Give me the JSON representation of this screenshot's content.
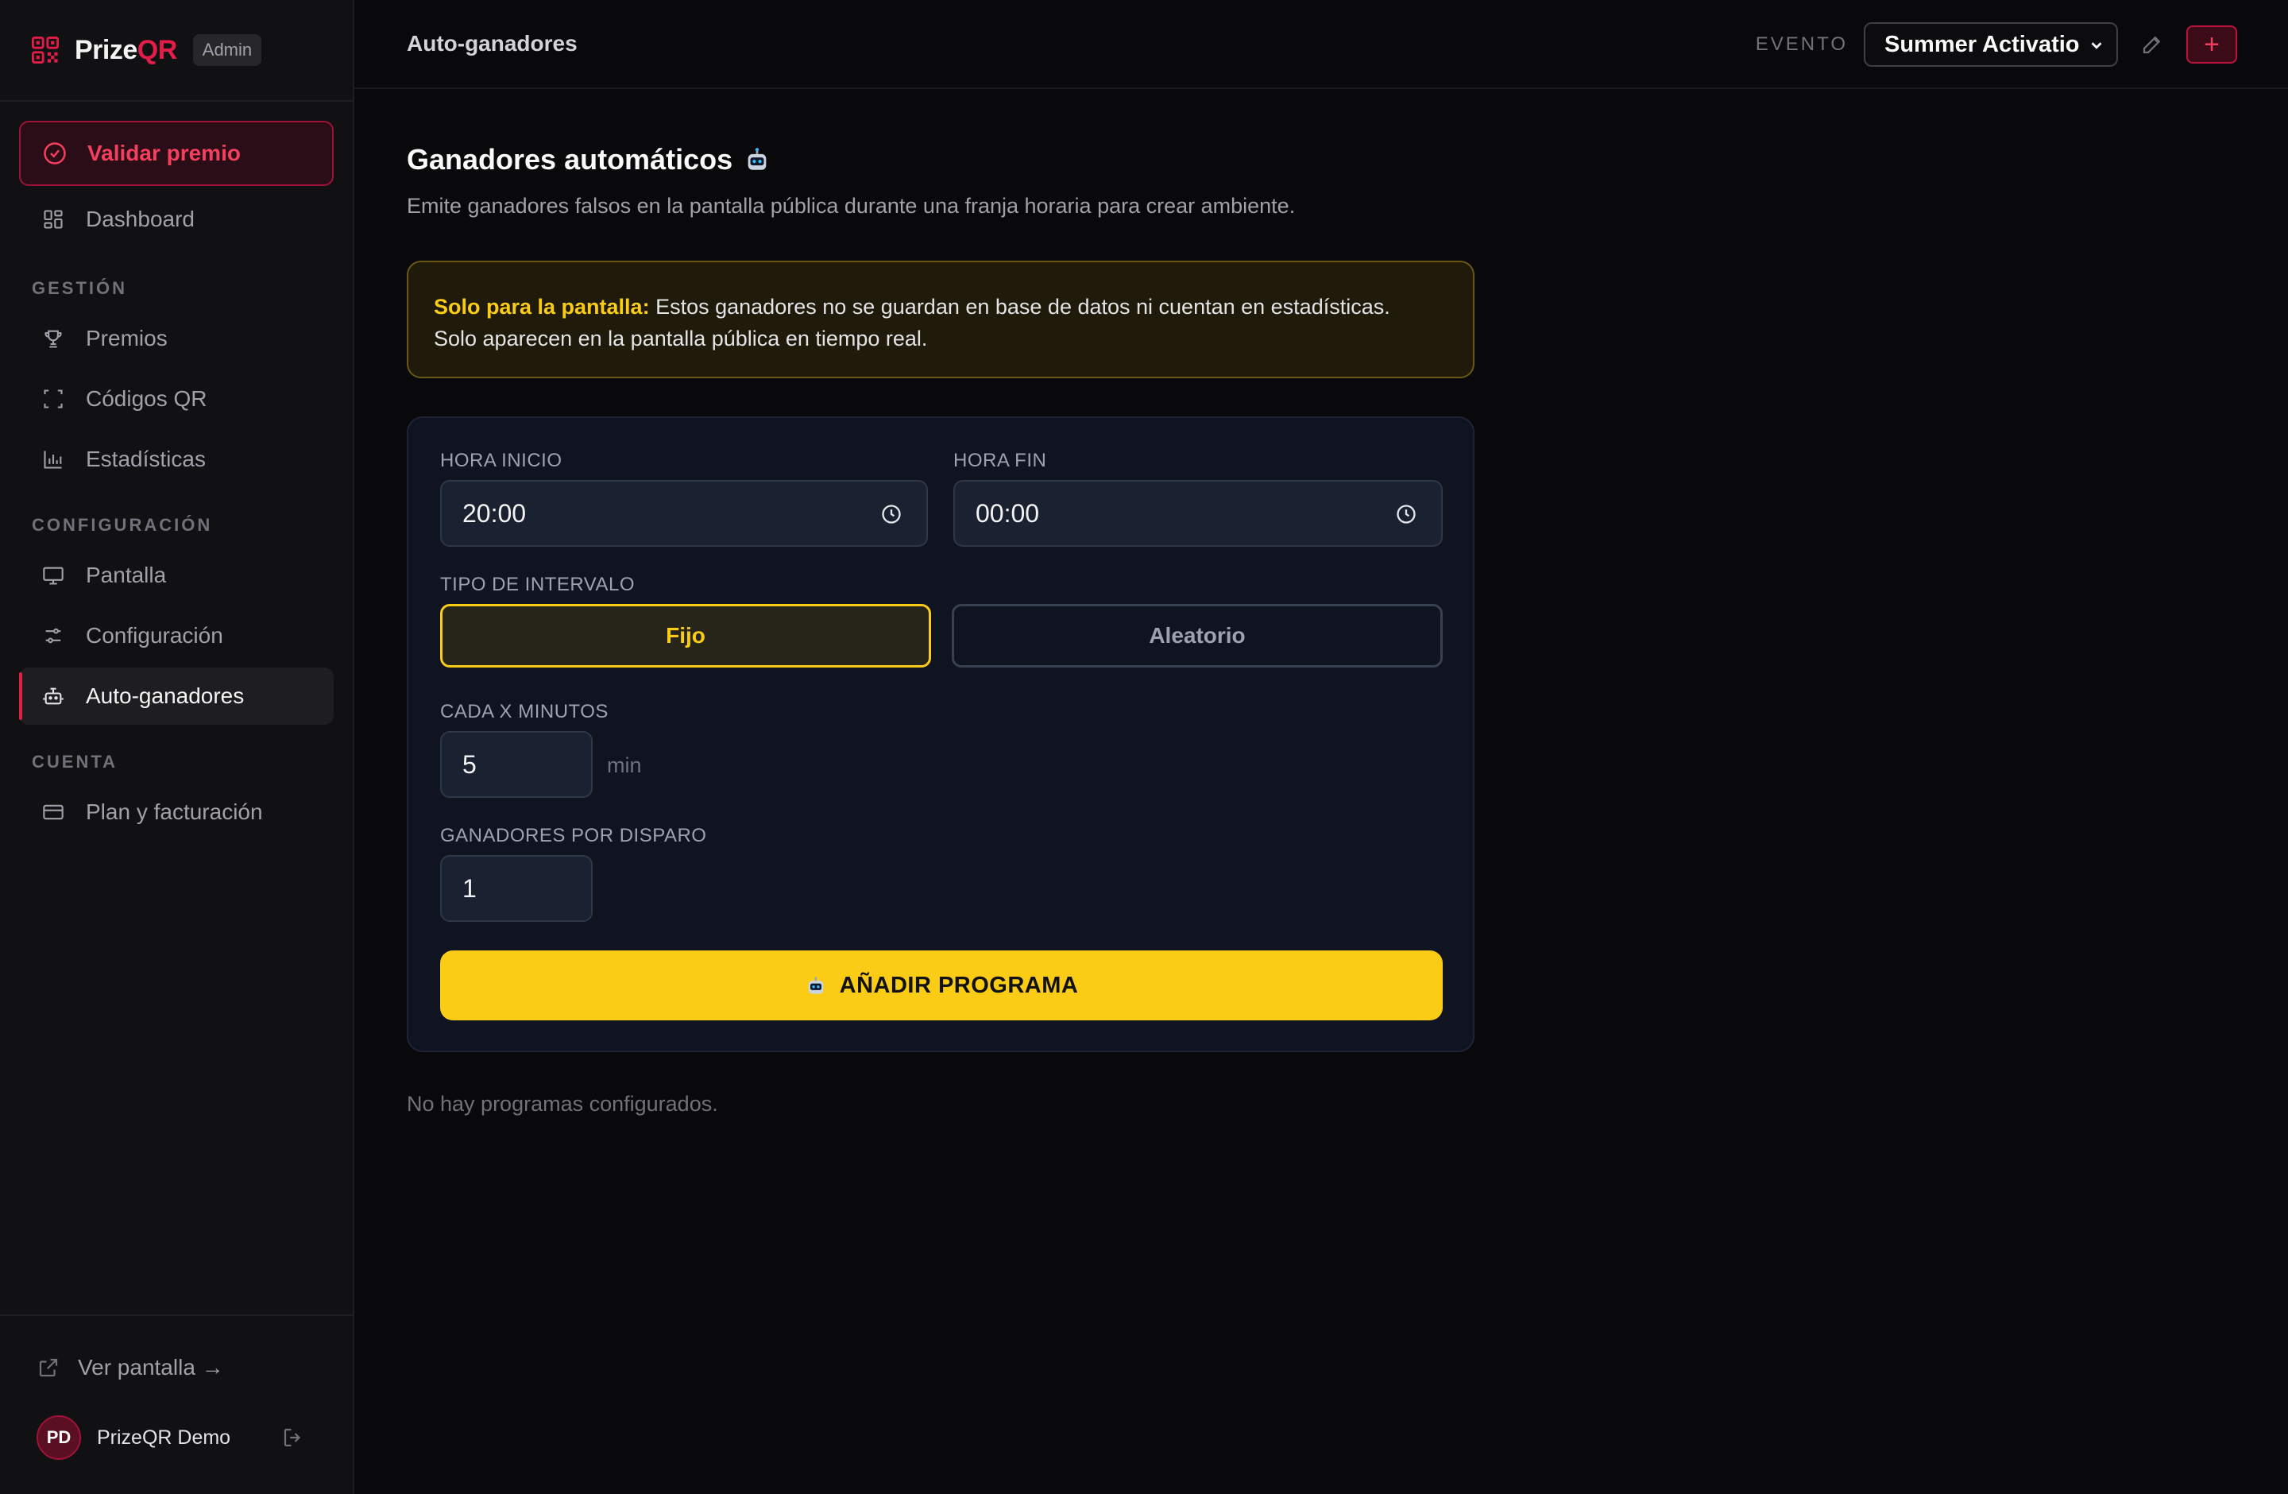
{
  "brand": {
    "name_main": "Prize",
    "name_accent": "QR",
    "badge": "Admin"
  },
  "sidebar": {
    "primary_action": "Validar premio",
    "dashboard": "Dashboard",
    "sections": {
      "gestion": "GESTIÓN",
      "configuracion": "CONFIGURACIÓN",
      "cuenta": "CUENTA"
    },
    "items": {
      "premios": "Premios",
      "codigos_qr": "Códigos QR",
      "estadisticas": "Estadísticas",
      "pantalla": "Pantalla",
      "configuracion": "Configuración",
      "auto_ganadores": "Auto-ganadores",
      "plan": "Plan y facturación"
    },
    "footer": {
      "ver_pantalla": "Ver pantalla →",
      "user_initials": "PD",
      "user_name": "PrizeQR Demo"
    }
  },
  "header": {
    "title": "Auto-ganadores",
    "evento_label": "EVENTO",
    "evento_selected": "Summer Activation",
    "add_label": "+"
  },
  "main": {
    "title": "Ganadores automáticos",
    "subtitle": "Emite ganadores falsos en la pantalla pública durante una franja horaria para crear ambiente.",
    "warning": {
      "strong": "Solo para la pantalla:",
      "text_line1": " Estos ganadores no se guardan en base de datos ni cuentan en estadísticas.",
      "text_line2": "Solo aparecen en la pantalla pública en tiempo real."
    },
    "form": {
      "hora_inicio_label": "HORA INICIO",
      "hora_inicio_value": "20:00",
      "hora_fin_label": "HORA FIN",
      "hora_fin_value": "00:00",
      "tipo_intervalo_label": "TIPO DE INTERVALO",
      "tipo_options": [
        "Fijo",
        "Aleatorio"
      ],
      "tipo_selected": "Fijo",
      "cada_label": "CADA X MINUTOS",
      "cada_value": "5",
      "cada_unit": "min",
      "ganadores_label": "GANADORES POR DISPARO",
      "ganadores_value": "1",
      "submit_label": "AÑADIR PROGRAMA"
    },
    "empty_message": "No hay programas configurados."
  },
  "colors": {
    "accent": "#e11d48",
    "warning": "#facc15",
    "background": "#09090b",
    "card": "#0f1420"
  }
}
